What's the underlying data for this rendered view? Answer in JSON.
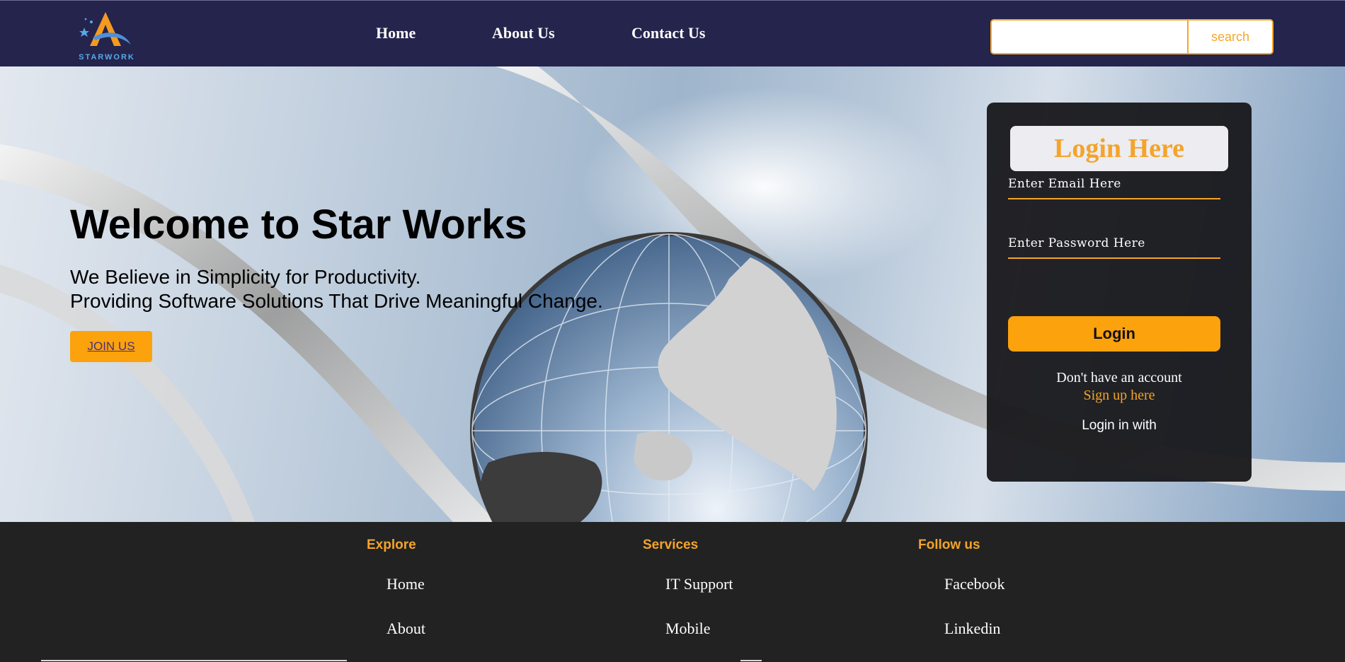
{
  "brand": {
    "logo_text": "STARWORK",
    "accent": "#f4a42a",
    "nav_bg": "#24244c"
  },
  "nav": {
    "links": [
      {
        "label": "Home"
      },
      {
        "label": "About Us"
      },
      {
        "label": "Contact Us"
      }
    ],
    "search": {
      "value": "",
      "placeholder": "",
      "button_label": "search"
    }
  },
  "hero": {
    "title": "Welcome to Star Works",
    "line1": "We Believe in Simplicity for Productivity.",
    "line2": "Providing Software Solutions That Drive Meaningful Change.",
    "cta_label": "JOIN US"
  },
  "login": {
    "heading": "Login Here",
    "email_placeholder": "Enter Email Here",
    "password_placeholder": "Enter Password Here",
    "button_label": "Login",
    "no_account_text": "Don't have an account",
    "signup_link": "Sign up here",
    "login_with_text": "Login in with"
  },
  "footer": {
    "columns": [
      {
        "heading": "Explore",
        "links": [
          "Home",
          "About"
        ]
      },
      {
        "heading": "Services",
        "links": [
          "IT Support",
          "Mobile"
        ]
      },
      {
        "heading": "Follow us",
        "links": [
          "Facebook",
          "Linkedin"
        ]
      }
    ]
  }
}
